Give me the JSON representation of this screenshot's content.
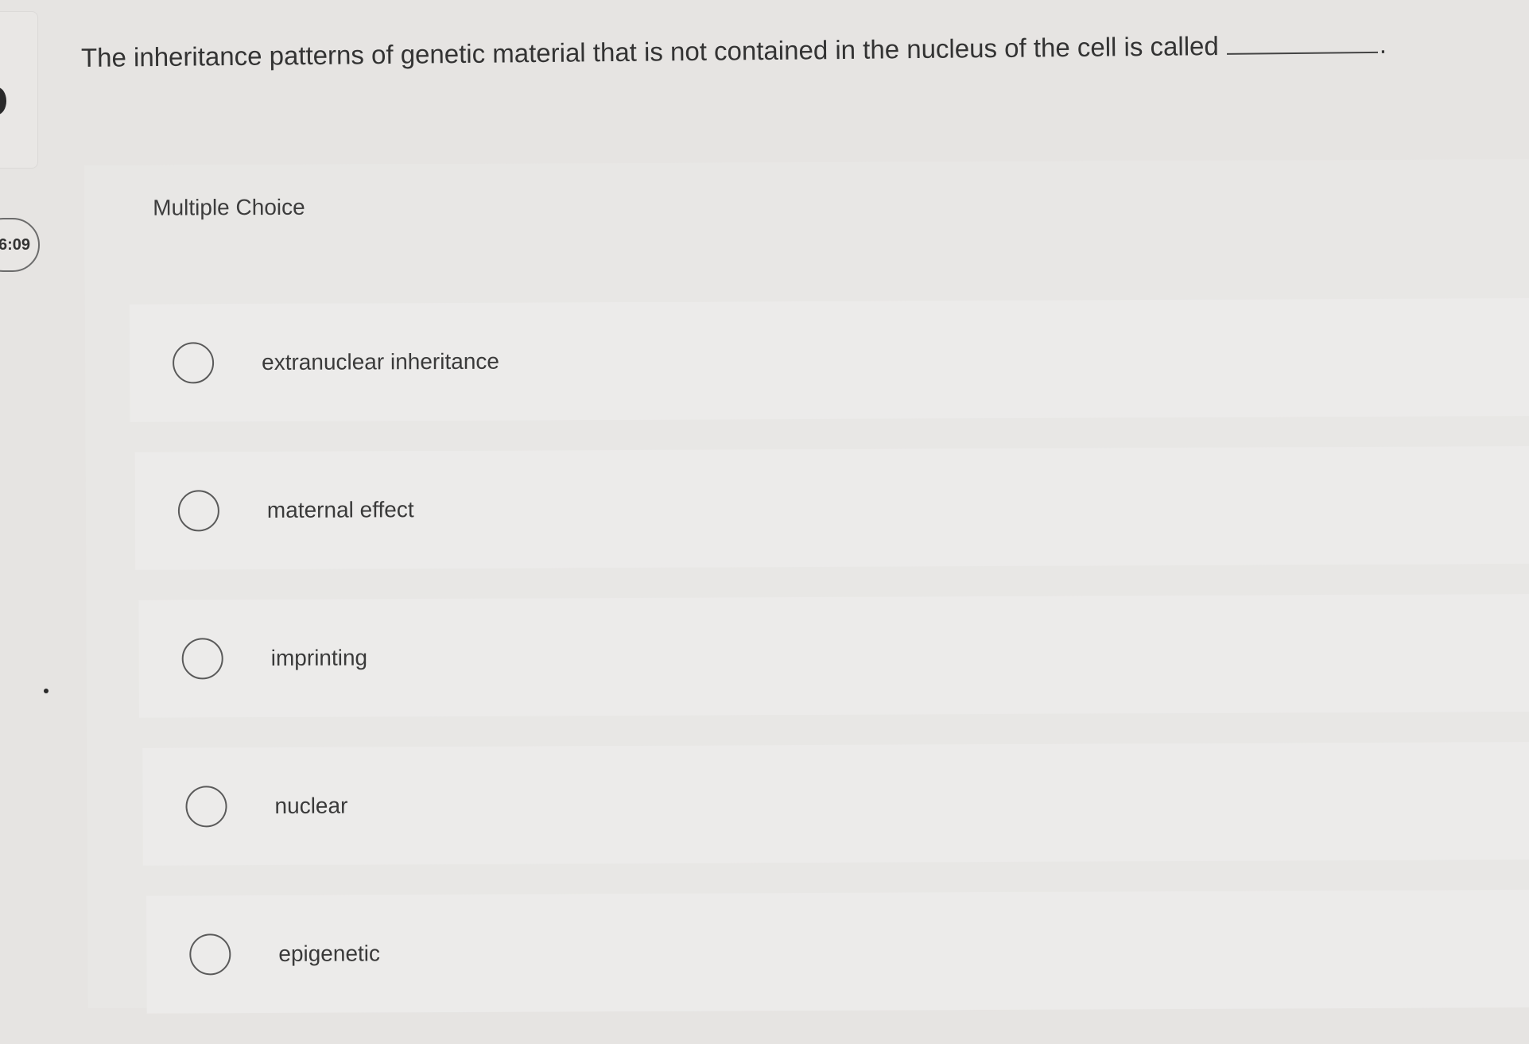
{
  "sidebar": {
    "timer": "6:09"
  },
  "question": {
    "text": "The inheritance patterns of genetic material that is not contained in the nucleus of the cell is called",
    "blank_suffix": "."
  },
  "answer_section": {
    "label": "Multiple Choice",
    "options": [
      {
        "label": "extranuclear inheritance",
        "selected": false
      },
      {
        "label": "maternal effect",
        "selected": false
      },
      {
        "label": "imprinting",
        "selected": false
      },
      {
        "label": "nuclear",
        "selected": false
      },
      {
        "label": "epigenetic",
        "selected": false
      }
    ]
  }
}
